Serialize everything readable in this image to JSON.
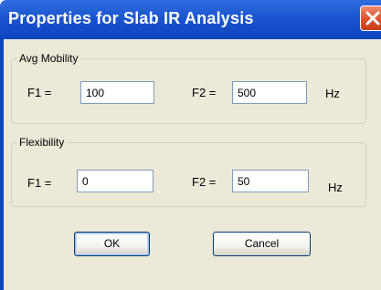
{
  "window": {
    "title": "Properties for Slab IR Analysis"
  },
  "avg_mobility": {
    "group_label": "Avg Mobility",
    "f1_label": "F1 =",
    "f1_value": "100",
    "f2_label": "F2 =",
    "f2_value": "500",
    "unit": "Hz"
  },
  "flexibility": {
    "group_label": "Flexibility",
    "f1_label": "F1 =",
    "f1_value": "0",
    "f2_label": "F2 =",
    "f2_value": "50",
    "unit": "Hz"
  },
  "buttons": {
    "ok_label": "OK",
    "cancel_label": "Cancel"
  },
  "colors": {
    "titlebar": "#0e44be",
    "dialog_face": "#ece9d8",
    "close_button": "#d9532d"
  },
  "icons": {
    "close": "close-icon"
  }
}
